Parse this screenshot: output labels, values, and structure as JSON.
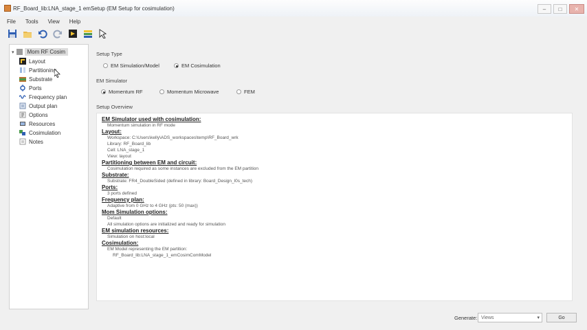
{
  "window": {
    "title": "RF_Board_lib:LNA_stage_1 emSetup (EM Setup for cosimulation)",
    "controls": {
      "minimize": "–",
      "maximize": "□",
      "close": "✕"
    }
  },
  "menu": [
    "File",
    "Tools",
    "View",
    "Help"
  ],
  "toolbar": {
    "icons": [
      "save-icon",
      "open-folder-icon",
      "undo-icon",
      "redo-icon",
      "simulate-icon",
      "layers-icon",
      "cursor-icon"
    ]
  },
  "sidebar": {
    "root_label": "Mom RF Cosim",
    "items": [
      {
        "label": "Layout",
        "icon": "layout-icon"
      },
      {
        "label": "Partitioning",
        "icon": "partition-icon"
      },
      {
        "label": "Substrate",
        "icon": "substrate-icon"
      },
      {
        "label": "Ports",
        "icon": "ports-icon"
      },
      {
        "label": "Frequency plan",
        "icon": "frequency-icon"
      },
      {
        "label": "Output plan",
        "icon": "output-icon"
      },
      {
        "label": "Options",
        "icon": "options-icon"
      },
      {
        "label": "Resources",
        "icon": "resources-icon"
      },
      {
        "label": "Cosimulation",
        "icon": "cosim-icon"
      },
      {
        "label": "Notes",
        "icon": "notes-icon"
      }
    ]
  },
  "setup_type": {
    "label": "Setup Type",
    "options": [
      {
        "label": "EM Simulation/Model",
        "selected": false
      },
      {
        "label": "EM Cosimulation",
        "selected": true
      }
    ]
  },
  "em_simulator": {
    "label": "EM Simulator",
    "options": [
      {
        "label": "Momentum RF",
        "selected": true
      },
      {
        "label": "Momentum Microwave",
        "selected": false
      },
      {
        "label": "FEM",
        "selected": false
      }
    ]
  },
  "overview": {
    "label": "Setup Overview",
    "sections": [
      {
        "heading": "EM Simulator used with cosimulation:",
        "lines": [
          "Momentum simulation in RF mode"
        ]
      },
      {
        "heading": "Layout:",
        "lines": [
          "Workspace: C:\\Users\\kelly\\ADS_workspaces\\temp\\RF_Board_wrk",
          "Library: RF_Board_lib",
          "Cell: LNA_stage_1",
          "View: layout"
        ]
      },
      {
        "heading": "Partitioning between EM and circuit:",
        "lines": [
          "Cosimulation required as some instances are excluded from the EM partition"
        ]
      },
      {
        "heading": "Substrate:",
        "lines": [
          "Substrate: FR4_DoubleSided (defined in library: Board_Design_l0s_tech)"
        ]
      },
      {
        "heading": "Ports:",
        "lines": [
          "3 ports defined"
        ]
      },
      {
        "heading": "Frequency plan:",
        "lines": [
          "Adaptive from 0 GHz to 4 GHz (pts: 50 (max))"
        ]
      },
      {
        "heading": "Mom Simulation options:",
        "lines": [
          "Default",
          "All simulation options are initialized and ready for simulation"
        ]
      },
      {
        "heading": "EM simulation resources:",
        "lines": [
          "Simulation on host:local"
        ]
      },
      {
        "heading": "Cosimulation:",
        "lines": [
          "EM Model representing the EM partition:"
        ],
        "sublines": [
          "RF_Board_lib:LNA_stage_1_emCosimComModel"
        ]
      }
    ]
  },
  "bottom": {
    "generate_label": "Generate:",
    "generate_value": "Views",
    "go_label": "Go"
  }
}
